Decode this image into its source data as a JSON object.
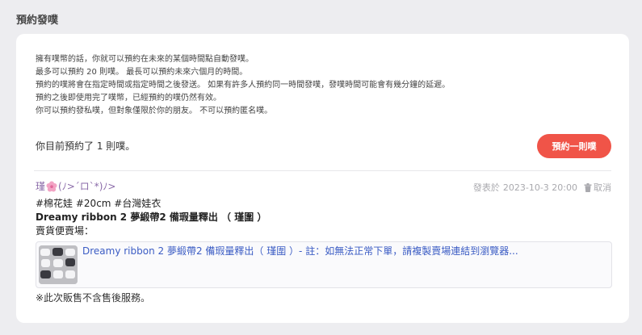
{
  "page": {
    "title": "預約發噗"
  },
  "description": {
    "lines": [
      "擁有噗幣的話，你就可以預約在未來的某個時間點自動發噗。",
      "最多可以預約 20 則噗。 最長可以預約未來六個月的時間。",
      "預約的噗將會在指定時間或指定時間之後發送。 如果有許多人預約同一時間發噗，發噗時間可能會有幾分鐘的延遲。",
      "預約之後即使用完了噗幣，已經預約的噗仍然有效。",
      "你可以預約發私噗，但對象僅限於你的朋友。 不可以預約匿名噗。"
    ]
  },
  "reservation": {
    "count_text": "你目前預約了 1 則噗。",
    "button_label": "預約一則噗"
  },
  "post": {
    "author_prefix": "瑾",
    "author_suffix": "(ﾉ>´ロ`*)ﾉ>",
    "posted_label": "發表於",
    "timestamp": "2023-10-3 20:00",
    "cancel_label": "取消",
    "line1": "#棉花娃 #20cm #台灣娃衣",
    "line2": "Dreamy ribbon 2 夢緞帶2 備瑕量釋出 （ 瑾圍 ）",
    "line3": "賣貨便賣場：",
    "link_text": "Dreamy ribbon 2 夢緞帶2 備瑕量釋出（ 瑾圍 ）- 註：如無法正常下單，請複製賣場連結到瀏覽器...",
    "footer": "※此次販售不含售後服務。"
  },
  "icons": {
    "author_icon": "cherry-blossom-icon",
    "cancel_icon": "trash-icon"
  },
  "colors": {
    "accent": "#f05448",
    "link": "#3b5cc4",
    "author": "#8a6aa8",
    "meta": "#a9a9ae"
  }
}
